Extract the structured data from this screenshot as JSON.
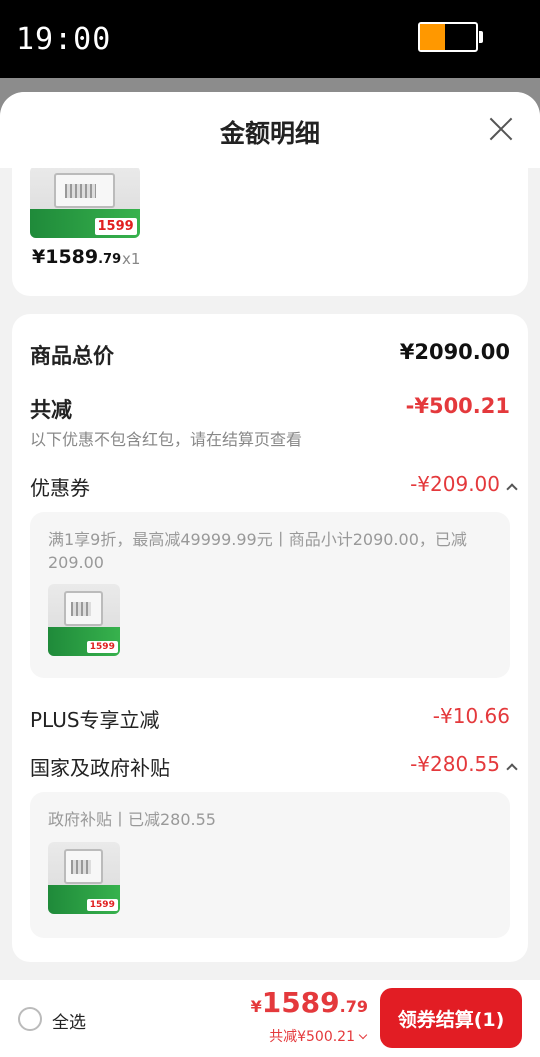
{
  "status": {
    "time": "19:00",
    "battery_level": 0.45,
    "battery_color": "#ff9800"
  },
  "sheet": {
    "title": "金额明细"
  },
  "product": {
    "price_main": "¥1589",
    "price_decimal": ".79",
    "quantity": "x1",
    "thumb_price": "1599"
  },
  "summary": {
    "total_label": "商品总价",
    "total_value": "¥2090.00",
    "discount_label": "共减",
    "discount_value": "-¥500.21",
    "note": "以下优惠不包含红包，请在结算页查看"
  },
  "coupon": {
    "label": "优惠券",
    "value": "-¥209.00",
    "detail": "满1享9折，最高减49999.99元丨商品小计2090.00，已减209.00"
  },
  "plus": {
    "label": "PLUS专享立减",
    "value": "-¥10.66"
  },
  "subsidy": {
    "label": "国家及政府补贴",
    "value": "-¥280.55",
    "detail": "政府补贴丨已减280.55"
  },
  "bottom": {
    "select_all": "全选",
    "currency": "¥",
    "price_main": "1589",
    "price_decimal": ".79",
    "discount": "共减¥500.21",
    "checkout": "领券结算(1)"
  },
  "colors": {
    "accent": "#e4393c",
    "button": "#e21d24"
  }
}
